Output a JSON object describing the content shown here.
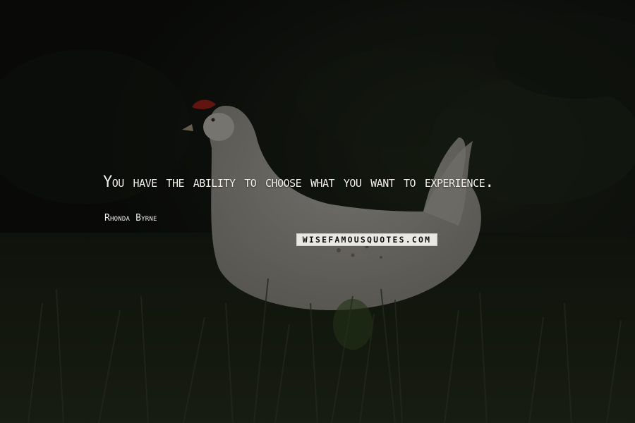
{
  "quote": {
    "text": "You have the ability to choose what you want to experience.",
    "author": "Rhonda Byrne"
  },
  "watermark": {
    "text": "WISEFAMOUSQUOTES.COM"
  },
  "scene": {
    "description_subject": "white-hen-in-grass",
    "colors": {
      "background": "#121410",
      "foliage": "#1c2418",
      "grass": "#2e3a24",
      "hen": "#d8d5cc",
      "comb": "#b3261e"
    }
  }
}
